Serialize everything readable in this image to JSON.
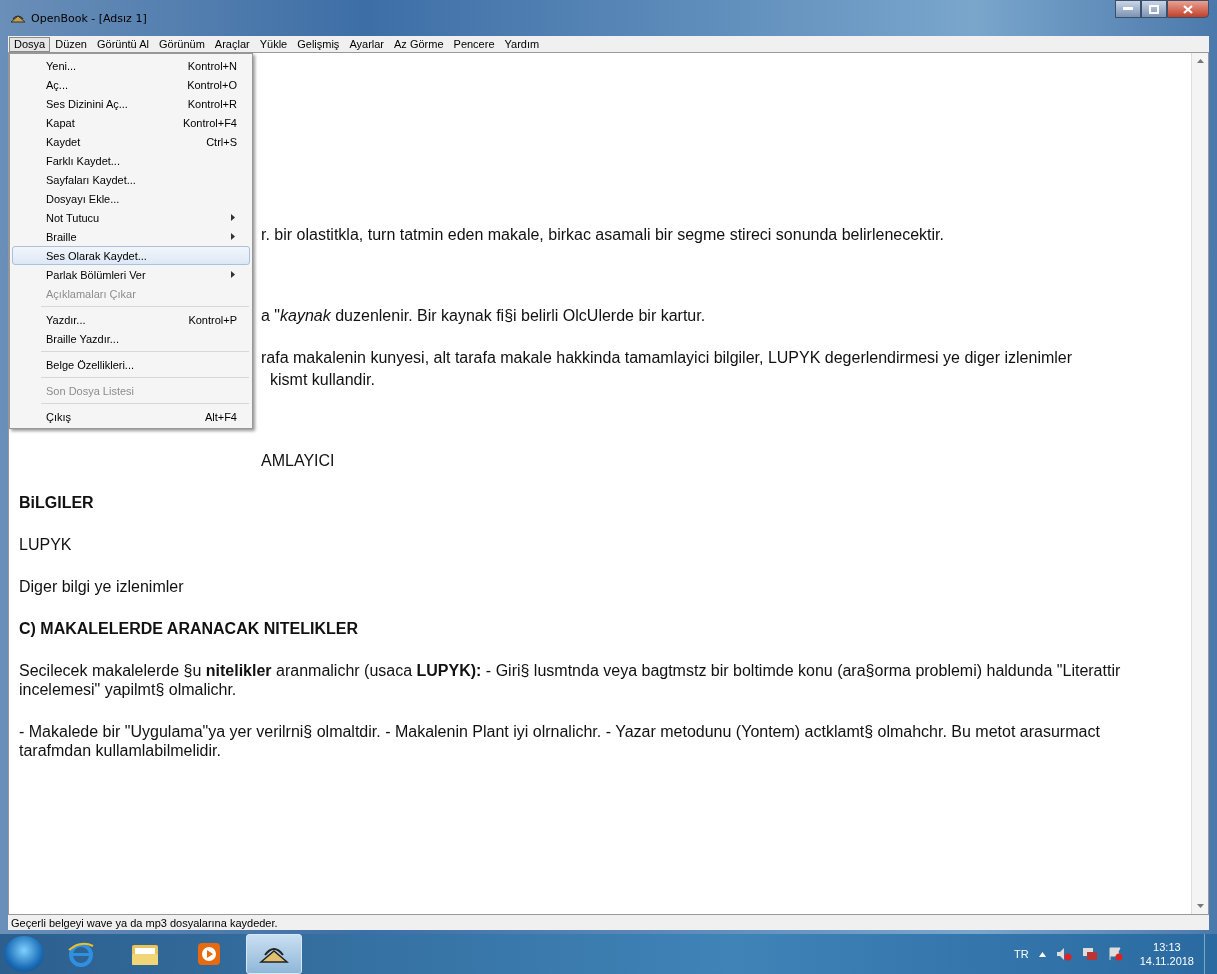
{
  "window": {
    "title": "OpenBook - [Adsız 1]"
  },
  "menubar": [
    {
      "label": "Dosya",
      "selected": true
    },
    {
      "label": "Düzen",
      "selected": false
    },
    {
      "label": "Görüntü Al",
      "selected": false
    },
    {
      "label": "Görünüm",
      "selected": false
    },
    {
      "label": "Araçlar",
      "selected": false
    },
    {
      "label": "Yükle",
      "selected": false
    },
    {
      "label": "Gelişmiş",
      "selected": false
    },
    {
      "label": "Ayarlar",
      "selected": false
    },
    {
      "label": "Az Görme",
      "selected": false
    },
    {
      "label": "Pencere",
      "selected": false
    },
    {
      "label": "Yardım",
      "selected": false
    }
  ],
  "menu": [
    {
      "label": "Yeni...",
      "shortcut": "Kontrol+N",
      "submenu": false,
      "disabled": false,
      "selected": false,
      "separator_before": false
    },
    {
      "label": "Aç...",
      "shortcut": "Kontrol+O",
      "submenu": false,
      "disabled": false,
      "selected": false,
      "separator_before": false
    },
    {
      "label": "Ses Dizinini Aç...",
      "shortcut": "Kontrol+R",
      "submenu": false,
      "disabled": false,
      "selected": false,
      "separator_before": false
    },
    {
      "label": "Kapat",
      "shortcut": "Kontrol+F4",
      "submenu": false,
      "disabled": false,
      "selected": false,
      "separator_before": false
    },
    {
      "label": "Kaydet",
      "shortcut": "Ctrl+S",
      "submenu": false,
      "disabled": false,
      "selected": false,
      "separator_before": false
    },
    {
      "label": "Farklı Kaydet...",
      "submenu": false,
      "disabled": false,
      "selected": false,
      "separator_before": false
    },
    {
      "label": "Sayfaları Kaydet...",
      "submenu": false,
      "disabled": false,
      "selected": false,
      "separator_before": false
    },
    {
      "label": "Dosyayı Ekle...",
      "submenu": false,
      "disabled": false,
      "selected": false,
      "separator_before": false
    },
    {
      "label": "Not Tutucu",
      "submenu": true,
      "disabled": false,
      "selected": false,
      "separator_before": false
    },
    {
      "label": "Braille",
      "submenu": true,
      "disabled": false,
      "selected": false,
      "separator_before": false
    },
    {
      "label": "Ses Olarak Kaydet...",
      "submenu": false,
      "disabled": false,
      "selected": true,
      "separator_before": false
    },
    {
      "label": "Parlak Bölümleri Ver",
      "submenu": true,
      "disabled": false,
      "selected": false,
      "separator_before": false
    },
    {
      "label": "Açıklamaları Çıkar",
      "submenu": false,
      "disabled": true,
      "selected": false,
      "separator_before": false
    },
    {
      "label": "Yazdır...",
      "shortcut": "Kontrol+P",
      "submenu": false,
      "disabled": false,
      "selected": false,
      "separator_before": true
    },
    {
      "label": "Braille Yazdır...",
      "submenu": false,
      "disabled": false,
      "selected": false,
      "separator_before": false
    },
    {
      "label": "Belge Özellikleri...",
      "submenu": false,
      "disabled": false,
      "selected": false,
      "separator_before": true
    },
    {
      "label": "Son Dosya Listesi",
      "submenu": false,
      "disabled": true,
      "selected": false,
      "separator_before": true
    },
    {
      "label": "Çıkış",
      "shortcut": "Alt+F4",
      "submenu": false,
      "disabled": false,
      "selected": false,
      "separator_before": true
    }
  ],
  "document": [
    {
      "kind": "partial",
      "lines": [
        "r. bir olastitkla, turn  tatmin eden makale, birkac asamali bir segme stireci sonunda belirlenecektir."
      ]
    },
    {
      "kind": "partial",
      "lines": [
        "a \"*kaynak* duzenlenir. Bir kaynak  fi§i belirli OlcUlerde bir kartur."
      ]
    },
    {
      "kind": "partial",
      "lines": [
        "rafa makalenin kunyesi, alt tarafa makale hakkinda tamamlayici bilgiler, LUPYK degerlendirmesi ye diger izlenimler",
        "kismt kullandir."
      ]
    },
    {
      "kind": "partial",
      "lines": [
        "AMLAYICI"
      ]
    },
    {
      "kind": "heading",
      "lines": [
        "BiLGILER"
      ]
    },
    {
      "kind": "text",
      "lines": [
        "LUPYK"
      ]
    },
    {
      "kind": "text",
      "lines": [
        "Diger bilgi ye izlenimler"
      ]
    },
    {
      "kind": "heading",
      "lines": [
        "C) MAKALELERDE ARANACAK NITELIKLER"
      ]
    },
    {
      "kind": "text",
      "lines": [
        "Secilecek makalelerde §u **nitelikler** aranmalichr (usaca **LUPYK):**  - Giri§ lusmtnda veya bagtmstz bir boltimde konu (ara§orma problemi) haldunda \"Literattir incelemesi\" yapilmt§ olmalichr."
      ]
    },
    {
      "kind": "text",
      "lines": [
        "- Makalede bir \"Uygulama\"ya yer verilrni§ olmaltdir.  -  Makalenin Plant iyi olrnalichr.  - Yazar metodunu (Yontem) actklamt§ olmahchr. Bu metot arasurmact tarafmdan kullamlabilmelidir."
      ]
    }
  ],
  "status_bar": "Geçerli belgeyi wave ya da mp3 dosyalarına kaydeder.",
  "taskbar": {
    "apps": [
      {
        "kind": "ie",
        "selected": false
      },
      {
        "kind": "folder",
        "selected": false
      },
      {
        "kind": "media",
        "selected": false
      },
      {
        "kind": "openbook",
        "selected": true
      }
    ],
    "language": "TR",
    "time": "13:13",
    "date": "14.11.2018"
  }
}
